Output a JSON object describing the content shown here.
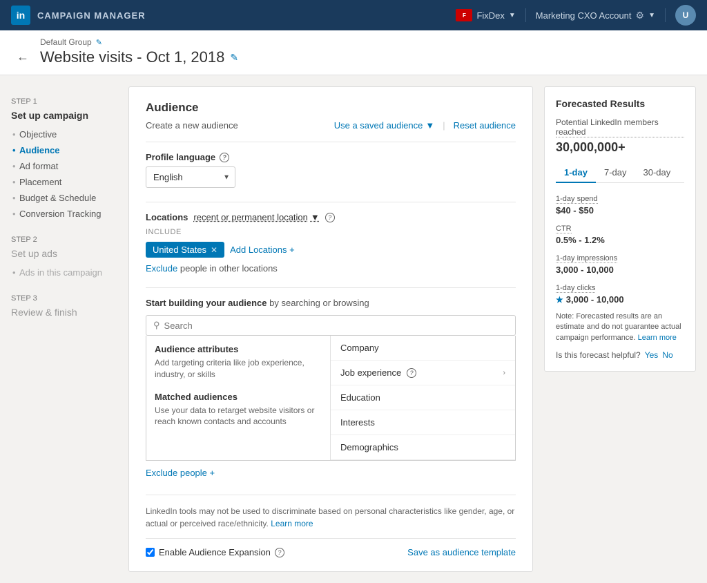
{
  "topnav": {
    "logo": "in",
    "title": "CAMPAIGN MANAGER",
    "account": "FixDex",
    "marketing_account": "Marketing CXO Account"
  },
  "header": {
    "breadcrumb": "Default Group",
    "page_title": "Website visits - Oct 1, 2018"
  },
  "sidebar": {
    "step1_label": "Step 1",
    "step1_title": "Set up campaign",
    "items": [
      {
        "id": "objective",
        "label": "Objective",
        "active": false
      },
      {
        "id": "audience",
        "label": "Audience",
        "active": true
      },
      {
        "id": "adformat",
        "label": "Ad format",
        "active": false
      },
      {
        "id": "placement",
        "label": "Placement",
        "active": false
      },
      {
        "id": "budget",
        "label": "Budget & Schedule",
        "active": false
      },
      {
        "id": "conversion",
        "label": "Conversion Tracking",
        "active": false
      }
    ],
    "step2_label": "Step 2",
    "step2_title": "Set up ads",
    "step2_items": [
      {
        "id": "ads",
        "label": "Ads in this campaign",
        "active": false
      }
    ],
    "step3_label": "Step 3",
    "step3_title": "Review & finish"
  },
  "audience": {
    "section_title": "Audience",
    "create_label": "Create a new audience",
    "saved_btn": "Use a saved audience",
    "reset_btn": "Reset audience",
    "profile_language_label": "Profile language",
    "language_value": "English",
    "locations_label": "Locations",
    "location_type": "recent or permanent location",
    "include_label": "INCLUDE",
    "location_tag": "United States",
    "add_location": "Add Locations +",
    "exclude_link": "Exclude",
    "exclude_text": "people in other locations",
    "builder_label_start": "Start building your audience",
    "builder_label_end": "by searching or browsing",
    "search_placeholder": "Search",
    "audience_attributes_title": "Audience attributes",
    "audience_attributes_desc": "Add targeting criteria like job experience, industry, or skills",
    "matched_audiences_title": "Matched audiences",
    "matched_audiences_desc": "Use your data to retarget website visitors or reach known contacts and accounts",
    "menu_items": [
      {
        "label": "Company",
        "has_help": false,
        "has_arrow": false
      },
      {
        "label": "Job experience",
        "has_help": true,
        "has_arrow": true
      },
      {
        "label": "Education",
        "has_help": false,
        "has_arrow": false
      },
      {
        "label": "Interests",
        "has_help": false,
        "has_arrow": false
      },
      {
        "label": "Demographics",
        "has_help": false,
        "has_arrow": false
      }
    ],
    "exclude_people_btn": "Exclude people +",
    "disclaimer_text": "LinkedIn tools may not be used to discriminate based on personal characteristics like gender, age, or actual or perceived race/ethnicity.",
    "learn_more": "Learn more",
    "enable_expansion_label": "Enable Audience Expansion",
    "save_template_btn": "Save as audience template"
  },
  "forecast": {
    "title": "Forecasted Results",
    "members_label": "Potential LinkedIn members reached",
    "members_value": "30,000,000+",
    "tabs": [
      "1-day",
      "7-day",
      "30-day"
    ],
    "active_tab": "1-day",
    "stats": [
      {
        "label": "1-day spend",
        "value": "$40 - $50"
      },
      {
        "label": "CTR",
        "value": "0.5% - 1.2%"
      },
      {
        "label": "1-day impressions",
        "value": "3,000 - 10,000",
        "star": false
      },
      {
        "label": "1-day clicks",
        "value": "3,000 - 10,000",
        "star": true
      }
    ],
    "note": "Note: Forecasted results are an estimate and do not guarantee actual campaign performance.",
    "learn_more": "Learn more",
    "helpful_label": "Is this forecast helpful?",
    "yes_label": "Yes",
    "no_label": "No"
  }
}
